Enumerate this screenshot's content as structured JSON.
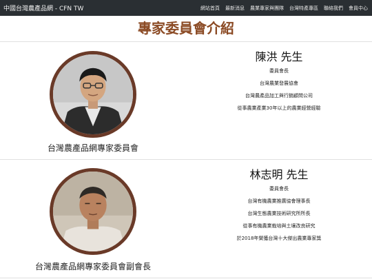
{
  "nav": {
    "brand": "中國台灣農產品網 - CFN TW",
    "links": [
      "網站首頁",
      "最新消息",
      "農業專家與團隊",
      "台灣特產專區",
      "聯絡我們",
      "會員中心"
    ]
  },
  "page": {
    "title": "專家委員會介紹"
  },
  "people": [
    {
      "name": "陳洪 先生",
      "caption": "台灣農產品網專家委員會",
      "lines": [
        "委員會長",
        "台灣農業發展協會",
        "台灣農產品加工與行銷顧問公司",
        "從事農業產業30年以上的農業經營經驗"
      ],
      "portrait": "portrait-man-glasses"
    },
    {
      "name": "林志明 先生",
      "caption": "台灣農產品網專家委員會副會長",
      "lines": [
        "委員會長",
        "台灣有機農業推廣協會理事長",
        "台灣生態農業技術研究所所長",
        "從事有機農業栽培與土壤改良研究",
        "於2018年榮獲台灣十大傑出農業專家獎"
      ],
      "portrait": "portrait-older-man"
    }
  ]
}
